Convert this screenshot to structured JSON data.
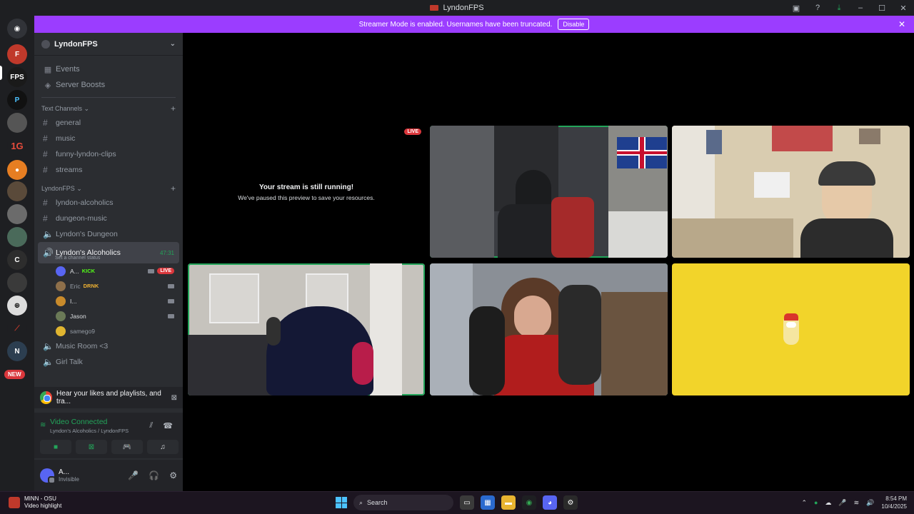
{
  "window": {
    "title": "LyndonFPS"
  },
  "banner": {
    "text": "Streamer Mode is enabled. Usernames have been truncated.",
    "button": "Disable"
  },
  "rail": {
    "new_badge": "NEW"
  },
  "guild": {
    "name": "LyndonFPS",
    "nav": [
      {
        "label": "Events",
        "icon": "calendar-icon"
      },
      {
        "label": "Server Boosts",
        "icon": "boost-icon"
      }
    ],
    "text_category": "Text Channels",
    "text_channels": [
      "general",
      "music",
      "funny-lyndon-clips",
      "streams"
    ],
    "category2": "LyndonFPS",
    "channels2": [
      {
        "label": "lyndon-alcoholics",
        "kind": "text"
      },
      {
        "label": "dungeon-music",
        "kind": "text"
      },
      {
        "label": "Lyndon's Dungeon",
        "kind": "voice"
      }
    ],
    "active_channel": {
      "label": "Lyndon's Alcoholics",
      "timer": "47:31",
      "status": "Set a channel status"
    },
    "voice_users": [
      {
        "name": "A...",
        "activity": "KICK",
        "live": "LIVE",
        "color": "#5865f2"
      },
      {
        "name": "Eric",
        "activity": "DRNK",
        "color": "#8e6f4a"
      },
      {
        "name": "I...",
        "activity": "",
        "color": "#c98b2b"
      },
      {
        "name": "Jason",
        "activity": "",
        "color": "#6b7a57"
      },
      {
        "name": "samego9",
        "activity": "",
        "color": "#e0b530"
      }
    ],
    "after_channels": [
      "Music Room <3",
      "Girl Talk"
    ]
  },
  "promo": {
    "text": "Hear your likes and playlists, and tra..."
  },
  "voice_panel": {
    "status": "Video Connected",
    "path": "Lyndon's Alcoholics / LyndonFPS"
  },
  "user": {
    "name": "A...",
    "status": "Invisible"
  },
  "stage": {
    "paused_title": "Your stream is still running!",
    "paused_sub": "We've paused this preview to save your resources.",
    "live": "LIVE"
  },
  "taskbar": {
    "media_title": "MINN - OSU",
    "media_sub": "Video highlight",
    "search": "Search",
    "time": "8:54 PM",
    "date": "10/4/2025"
  },
  "colors": {
    "accent": "#9b3dff",
    "speaking": "#23a55a",
    "live": "#da373c"
  }
}
